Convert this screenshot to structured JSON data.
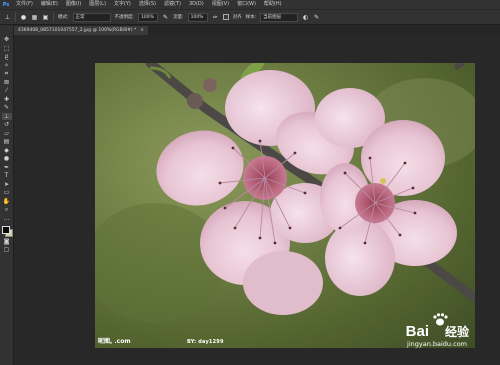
{
  "menu": {
    "items": [
      "文件(F)",
      "编辑(E)",
      "图像(I)",
      "图层(L)",
      "文字(Y)",
      "选择(S)",
      "滤镜(T)",
      "3D(D)",
      "视图(V)",
      "窗口(W)",
      "帮助(H)"
    ],
    "logo": "Ps"
  },
  "options_bar": {
    "mode_label": "模式:",
    "mode_value": "正常",
    "opacity_label": "不透明度:",
    "opacity_value": "100%",
    "flow_label": "流量:",
    "flow_value": "100%",
    "aligned_label": "对齐",
    "sample_label": "样本:",
    "sample_value": "当前图层"
  },
  "document": {
    "tab_title": "4369408_0857101047557_2.jpg @ 100%(RGB/8#) *",
    "close_glyph": "×"
  },
  "photo": {
    "watermark_left": "昵图, .com",
    "watermark_by": "BY: day1299",
    "baidu_left": "Bai",
    "baidu_right": "经验",
    "baidu_url": "jingyan.baidu.com"
  },
  "colors": {
    "foreground": "#0a0a0a",
    "background": "#d8d2a8",
    "accent": "#4aa3ff"
  }
}
